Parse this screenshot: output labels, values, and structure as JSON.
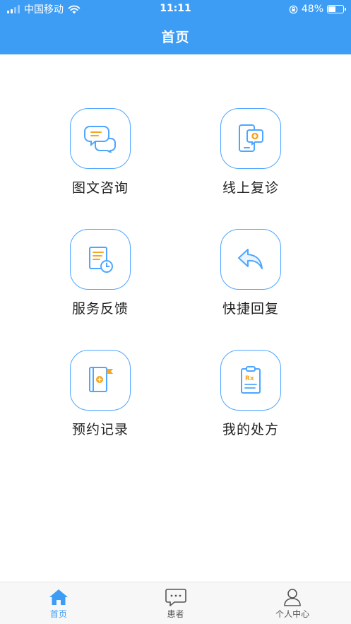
{
  "status_bar": {
    "carrier": "中国移动",
    "time": "11:11",
    "battery_percent": "48%",
    "battery_level": 0.48,
    "signal_bars_active": 2
  },
  "nav": {
    "title": "首页"
  },
  "features": [
    {
      "label": "图文咨询",
      "icon": "chat-bubbles-icon"
    },
    {
      "label": "线上复诊",
      "icon": "phone-medical-icon"
    },
    {
      "label": "服务反馈",
      "icon": "document-clock-icon"
    },
    {
      "label": "快捷回复",
      "icon": "reply-arrow-icon"
    },
    {
      "label": "预约记录",
      "icon": "medical-book-icon"
    },
    {
      "label": "我的处方",
      "icon": "prescription-icon"
    }
  ],
  "tabbar": {
    "items": [
      {
        "label": "首页",
        "icon": "home-icon",
        "active": true
      },
      {
        "label": "患者",
        "icon": "message-icon",
        "active": false
      },
      {
        "label": "个人中心",
        "icon": "person-icon",
        "active": false
      }
    ]
  },
  "colors": {
    "primary": "#3d9df5",
    "icon_blue": "#4da6ff",
    "icon_orange": "#f5a623"
  }
}
